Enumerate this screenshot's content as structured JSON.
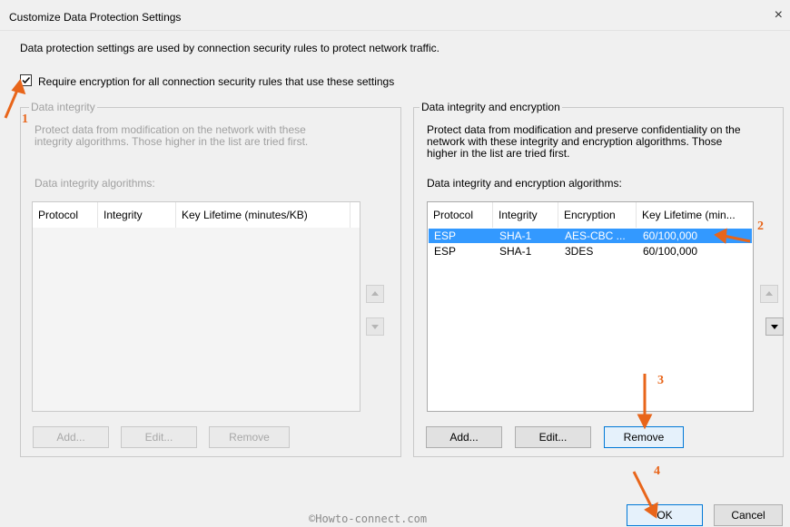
{
  "window": {
    "title": "Customize Data Protection Settings",
    "close_label": "×"
  },
  "description": "Data protection settings are used by connection security rules to protect network traffic.",
  "require_encryption": {
    "label": "Require encryption for all connection security rules that use these settings",
    "checked": true
  },
  "integrity_group": {
    "legend": "Data integrity",
    "text_line1": "Protect data from modification on the network with these",
    "text_line2": "integrity algorithms. Those higher in the list are tried first.",
    "list_label": "Data integrity algorithms:",
    "columns": [
      "Protocol",
      "Integrity",
      "Key Lifetime (minutes/KB)"
    ],
    "rows": [],
    "buttons": {
      "add": "Add...",
      "edit": "Edit...",
      "remove": "Remove"
    }
  },
  "encryption_group": {
    "legend": "Data integrity and encryption",
    "text_line1": "Protect data from modification and preserve confidentiality on the",
    "text_line2": "network with these integrity and encryption algorithms.  Those",
    "text_line3": "higher in the list are tried first.",
    "list_label": "Data integrity and encryption algorithms:",
    "columns": [
      "Protocol",
      "Integrity",
      "Encryption",
      "Key Lifetime (min..."
    ],
    "rows": [
      {
        "protocol": "ESP",
        "integrity": "SHA-1",
        "encryption": "AES-CBC ...",
        "lifetime": "60/100,000",
        "selected": true
      },
      {
        "protocol": "ESP",
        "integrity": "SHA-1",
        "encryption": "3DES",
        "lifetime": "60/100,000",
        "selected": false
      }
    ],
    "buttons": {
      "add": "Add...",
      "edit": "Edit...",
      "remove": "Remove"
    }
  },
  "footer": {
    "ok": "OK",
    "cancel": "Cancel"
  },
  "annotations": {
    "n1": "1",
    "n2": "2",
    "n3": "3",
    "n4": "4",
    "color": "#e8651a"
  },
  "watermark": "©Howto-connect.com"
}
